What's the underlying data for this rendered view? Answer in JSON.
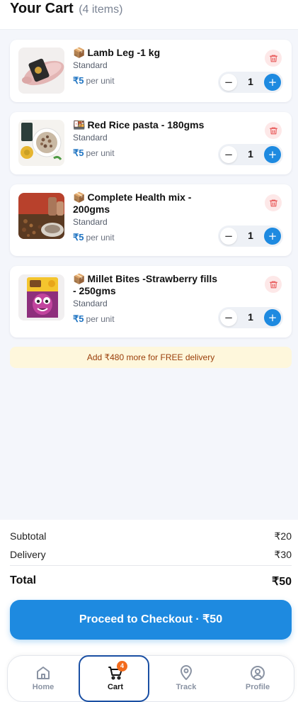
{
  "header": {
    "title": "Your Cart",
    "count_label": "(4 items)"
  },
  "items": [
    {
      "emoji": "📦",
      "name": "Lamb Leg -1 kg",
      "variant": "Standard",
      "price": "₹5",
      "unit": "per unit",
      "quantity": "1",
      "minus": "−",
      "plus": "+"
    },
    {
      "emoji": "🍱",
      "name": "Red Rice pasta - 180gms",
      "variant": "Standard",
      "price": "₹5",
      "unit": "per unit",
      "quantity": "1",
      "minus": "−",
      "plus": "+"
    },
    {
      "emoji": "📦",
      "name": "Complete Health mix - 200gms",
      "variant": "Standard",
      "price": "₹5",
      "unit": "per unit",
      "quantity": "1",
      "minus": "−",
      "plus": "+"
    },
    {
      "emoji": "📦",
      "name": "Millet Bites -Strawberry fills - 250gms",
      "variant": "Standard",
      "price": "₹5",
      "unit": "per unit",
      "quantity": "1",
      "minus": "−",
      "plus": "+"
    }
  ],
  "delivery_banner": "Add ₹480 more for FREE delivery",
  "summary": {
    "subtotal_label": "Subtotal",
    "subtotal_value": "₹20",
    "delivery_label": "Delivery",
    "delivery_value": "₹30",
    "total_label": "Total",
    "total_value": "₹50"
  },
  "checkout_label": "Proceed to Checkout · ₹50",
  "nav": {
    "home": "Home",
    "cart": "Cart",
    "cart_badge": "4",
    "track": "Track",
    "profile": "Profile"
  },
  "colors": {
    "accent": "#1e8ae0",
    "price": "#1f74c2",
    "badge": "#f26b1d",
    "banner_bg": "#fef7dc",
    "banner_text": "#9a3e0a",
    "trash": "#e85a5a"
  }
}
